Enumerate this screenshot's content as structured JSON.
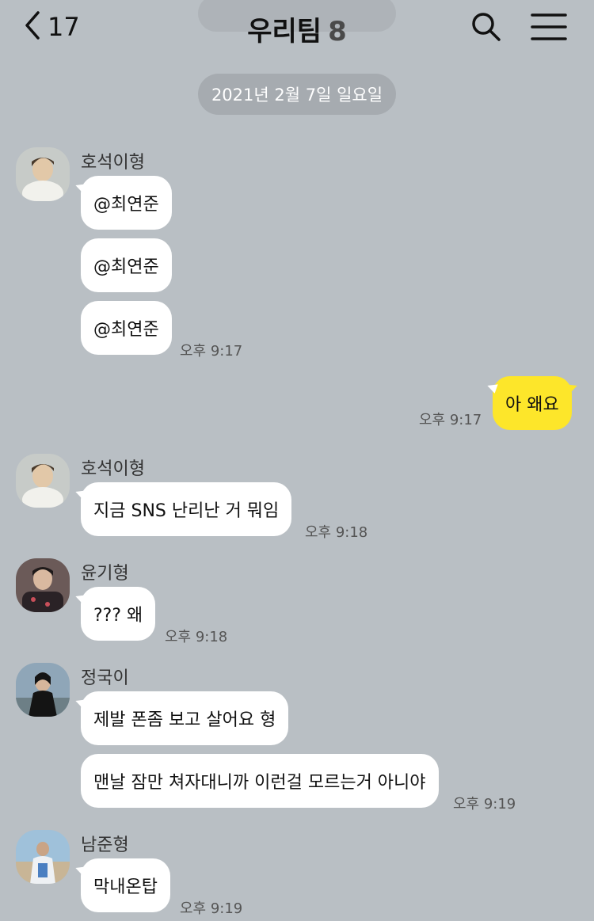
{
  "header": {
    "back_count": "17",
    "title": "우리팀",
    "member_count": "8"
  },
  "date_divider": "2021년 2월 7일 일요일",
  "messages": [
    {
      "sender": "호석이형",
      "bubbles": [
        "@최연준",
        "@최연준",
        "@최연준"
      ],
      "time": "오후 9:17"
    },
    {
      "mine": true,
      "bubbles": [
        "아 왜요"
      ],
      "time": "오후 9:17"
    },
    {
      "sender": "호석이형",
      "bubbles": [
        "지금 SNS 난리난 거 뭐임"
      ],
      "time": "오후 9:18"
    },
    {
      "sender": "윤기형",
      "bubbles": [
        "??? 왜"
      ],
      "time": "오후 9:18"
    },
    {
      "sender": "정국이",
      "bubbles": [
        "제발 폰좀 보고 살어요 형",
        "맨날 잠만 쳐자대니까 이런걸 모르는거 아니야"
      ],
      "time": "오후 9:19"
    },
    {
      "sender": "남준형",
      "bubbles": [
        "막내온탑"
      ],
      "time": "오후 9:19"
    }
  ],
  "icons": {
    "back": "chevron-left-icon",
    "search": "search-icon",
    "menu": "hamburger-menu-icon"
  },
  "colors": {
    "background": "#b9bfc4",
    "my_bubble": "#fde62a",
    "other_bubble": "#ffffff",
    "date_pill": "#a6abb0"
  }
}
